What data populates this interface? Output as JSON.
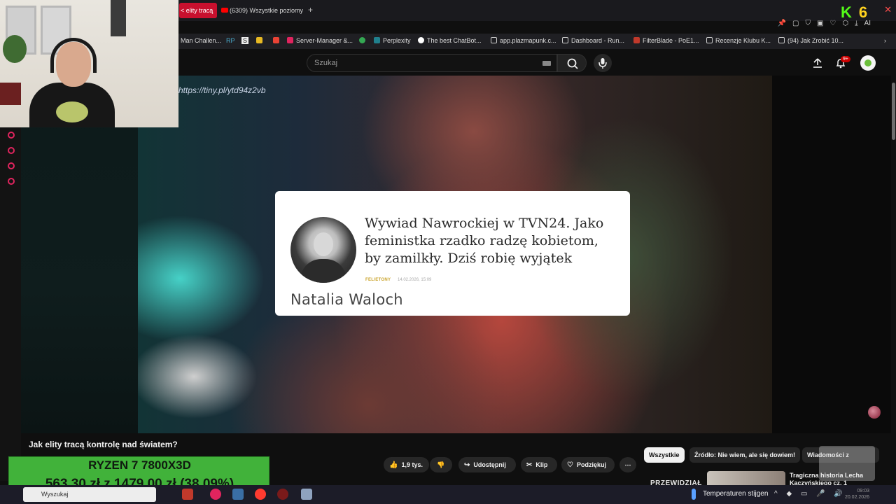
{
  "browser": {
    "active_tab_title": "< elity tracą",
    "second_tab_title": "(6309) Wszystkie poziomy",
    "new_tab": "+",
    "extension_badge_k": "K",
    "extension_badge_6": "6",
    "ai_label": "AI"
  },
  "bookmarks": [
    {
      "label": "Man Challen...",
      "color": "#888888"
    },
    {
      "label": "RP",
      "color": "#4aa8c9"
    },
    {
      "label": "S",
      "color": "#ffffff"
    },
    {
      "label": "Server-Manager &...",
      "color": "#e0245e"
    },
    {
      "label": "Perplexity",
      "color": "#20808d"
    },
    {
      "label": "The best ChatBot...",
      "color": "#ffffff"
    },
    {
      "label": "app.plazmapunk.c...",
      "color": "#cccccc"
    },
    {
      "label": "Dashboard - Run...",
      "color": "#cccccc"
    },
    {
      "label": "FilterBlade - PoE1...",
      "color": "#c0392b"
    },
    {
      "label": "Recenzje Klubu K...",
      "color": "#cccccc"
    },
    {
      "label": "(94) Jak Zrobić 10...",
      "color": "#cccccc"
    }
  ],
  "search": {
    "placeholder": "Szukaj"
  },
  "header": {
    "notifications_badge": "9+"
  },
  "video": {
    "overlay_url": "https://tiny.pl/ytd94z2vb",
    "title": "Jak elity tracą kontrolę nad światem?"
  },
  "article_card": {
    "headline": "Wywiad Nawrockiej w TVN24. Jako feministka rzadko radzę kobietom, by zamilkły. Dziś robię wyjątek",
    "category": "FELIETONY",
    "date": "14.02.2026, 15:09",
    "author": "Natalia Waloch"
  },
  "actions": {
    "likes": "1,9 tys.",
    "share": "Udostępnij",
    "clip": "Klip",
    "thanks": "Podziękuj",
    "more": "⋯"
  },
  "chips": {
    "all": "Wszystkie",
    "source": "Źródło: Nie wiem, ale się dowiem!",
    "news": "Wiadomości z"
  },
  "recommendation": {
    "label": "PRZEWIDZIAŁ",
    "title": "Tragiczna historia Lecha Kaczyńskiego cz. 1"
  },
  "promo": {
    "product": "RYZEN 7 7800X3D",
    "price_text": "563,30 zł z 1479,00 zł (38.09%)"
  },
  "taskbar": {
    "search_placeholder": "Wyszukaj",
    "weather": "Temperaturen stijgen",
    "clock_line1": "09:03",
    "clock_line2": "20.02.2026"
  }
}
